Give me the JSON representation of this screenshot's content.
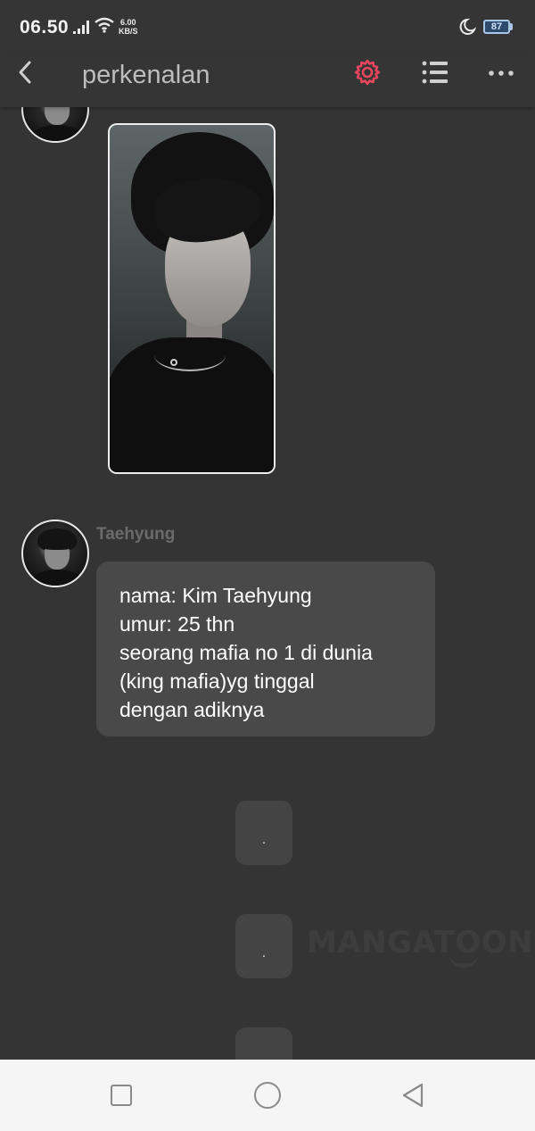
{
  "status_bar": {
    "time": "06.50",
    "net_speed_value": "6.00",
    "net_speed_unit": "KB/S",
    "battery": "87"
  },
  "header": {
    "title": "perkenalan",
    "icons": [
      "back-icon",
      "gear-icon",
      "list-icon",
      "more-icon"
    ],
    "accent_color": "#e8465c"
  },
  "messages": [
    {
      "type": "image",
      "avatar": "avatar"
    },
    {
      "type": "text",
      "sender": "Taehyung",
      "lines": [
        "nama: Kim Taehyung",
        "umur: 25 thn",
        "seorang mafia no 1 di dunia",
        "(king mafia)yg tinggal",
        "dengan adiknya"
      ]
    },
    {
      "type": "text",
      "text": "."
    },
    {
      "type": "text",
      "text": "."
    }
  ],
  "watermark": "MANGATOON",
  "nav_bar": {
    "icons": [
      "recent-apps-icon",
      "home-icon",
      "back-nav-icon"
    ]
  }
}
